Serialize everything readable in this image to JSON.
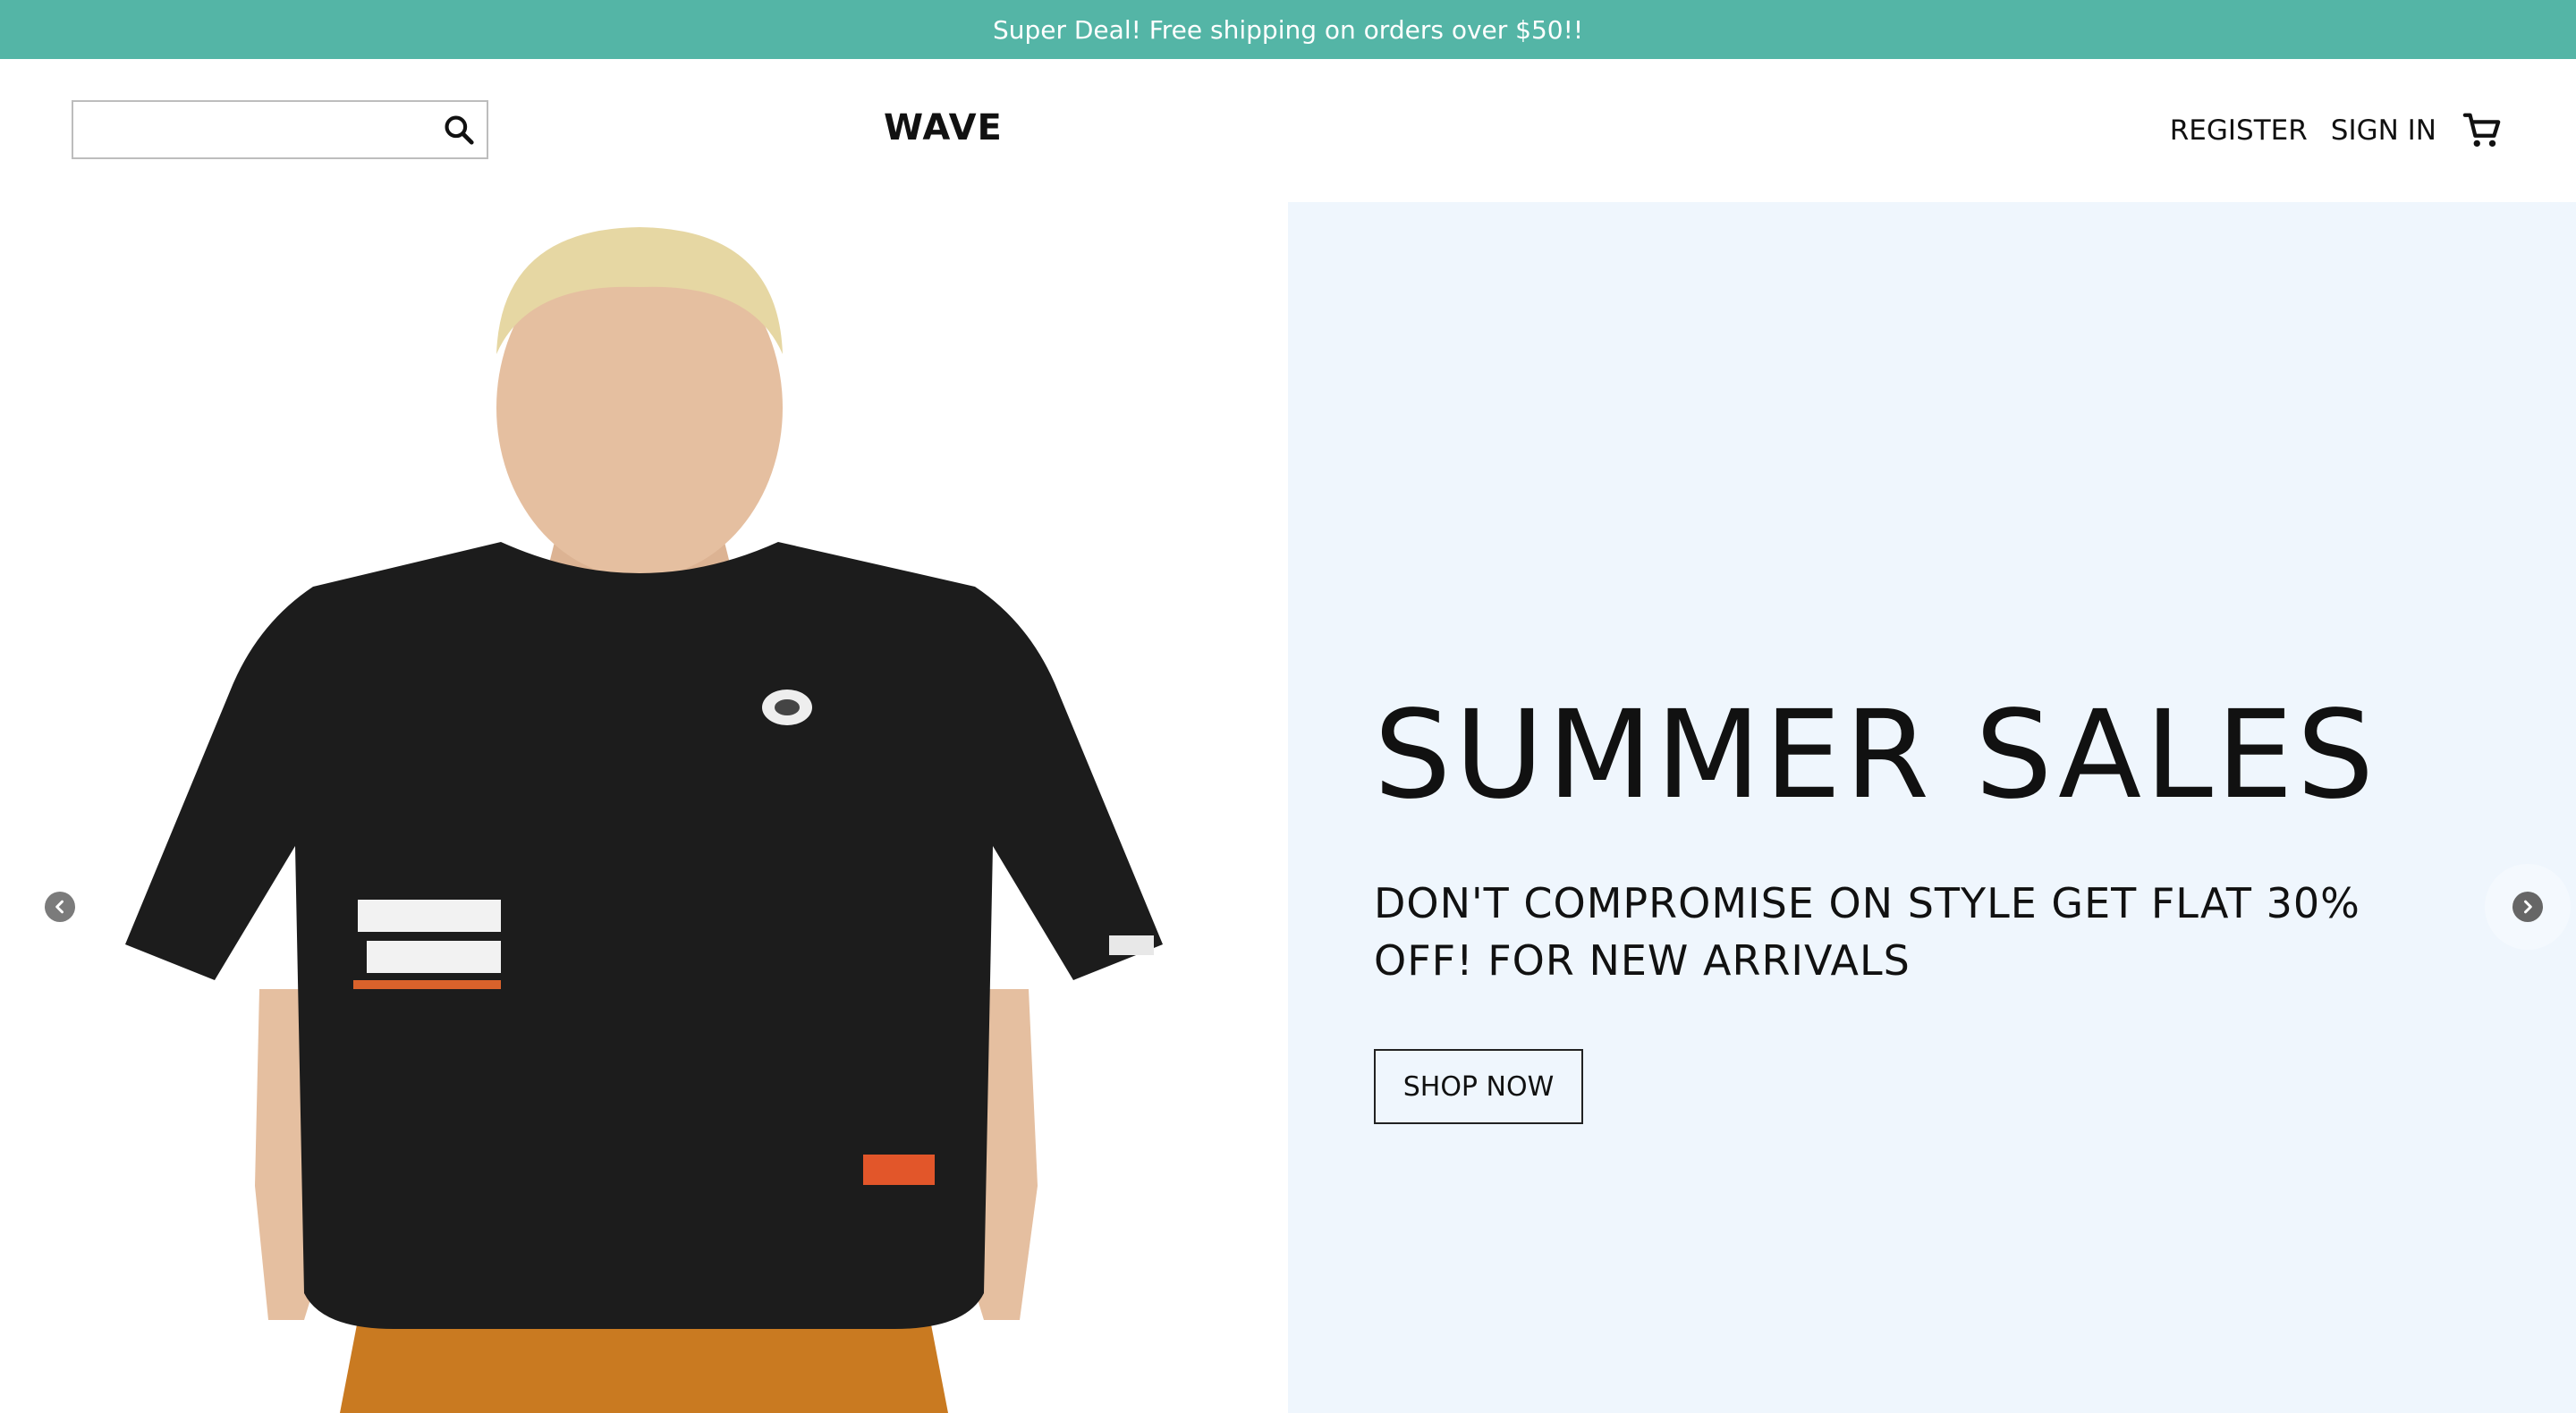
{
  "announcement": "Super Deal! Free shipping on orders over $50!!",
  "search": {
    "value": "",
    "placeholder": ""
  },
  "brand": "WAVE",
  "nav": {
    "register": "REGISTER",
    "sign_in": "SIGN IN"
  },
  "icons": {
    "search": "search-icon",
    "cart": "shopping-cart-icon",
    "arrow_left": "chevron-left-icon",
    "arrow_right": "chevron-right-icon"
  },
  "slide": {
    "title": "SUMMER SALES",
    "description": "DON'T COMPROMISE ON STYLE GET FLAT 30% OFF! FOR NEW ARRIVALS",
    "button": "SHOP NOW"
  },
  "colors": {
    "announcement_bg": "#54b5a6",
    "slide_bg": "#eff6fd",
    "tshirt": "#1c1c1c",
    "pants": "#c97a21",
    "hair": "#e6d7a3",
    "skin": "#e5bfa0"
  }
}
